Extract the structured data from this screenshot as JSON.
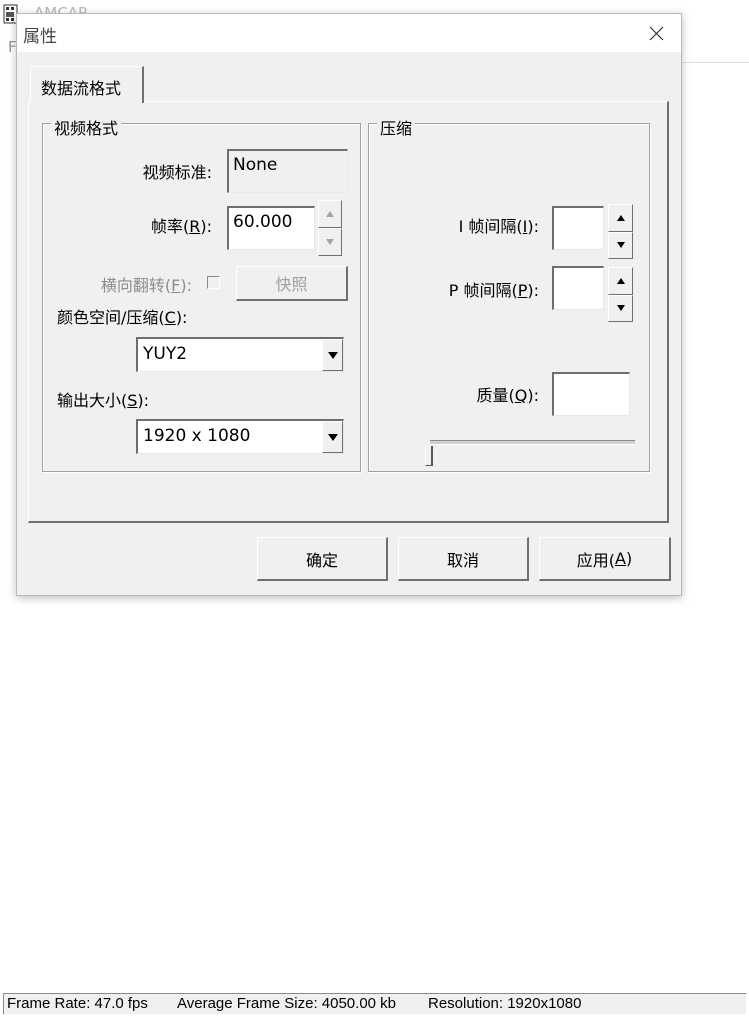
{
  "app": {
    "title": "AMCAP",
    "menu_letter": "F"
  },
  "dialog": {
    "title": "属性",
    "tab_label": "数据流格式",
    "video_format": {
      "group_label": "视频格式",
      "standard_label": "视频标准:",
      "standard_value": "None",
      "frame_rate_label": "帧率(",
      "frame_rate_key": "R",
      "frame_rate_suffix": "):",
      "frame_rate_value": "60.000",
      "flip_label": "横向翻转(",
      "flip_key": "F",
      "flip_suffix": "):",
      "snapshot_label": "快照",
      "color_space_label": "颜色空间/压缩(",
      "color_space_key": "C",
      "color_space_suffix": "):",
      "color_space_value": "YUY2",
      "output_size_label": "输出大小(",
      "output_size_key": "S",
      "output_size_suffix": "):",
      "output_size_value": "1920 x 1080"
    },
    "compression": {
      "group_label": "压缩",
      "i_frame_label": "I 帧间隔(",
      "i_frame_key": "I",
      "i_frame_suffix": "):",
      "i_frame_value": "",
      "p_frame_label": "P 帧间隔(",
      "p_frame_key": "P",
      "p_frame_suffix": "):",
      "p_frame_value": "",
      "quality_label": "质量(",
      "quality_key": "Q",
      "quality_suffix": "):",
      "quality_value": "",
      "quality_slider_level": 0
    },
    "buttons": {
      "ok": "确定",
      "cancel": "取消",
      "apply_label": "应用(",
      "apply_key": "A",
      "apply_suffix": ")"
    }
  },
  "statusbar": {
    "frame_rate": "Frame Rate: 47.0 fps",
    "avg_frame_size": "Average Frame Size: 4050.00 kb",
    "resolution": "Resolution: 1920x1080"
  },
  "icons": {
    "app": "film-reel-icon",
    "close": "close-icon",
    "spin_up": "arrow-up-icon",
    "spin_down": "arrow-down-icon",
    "dropdown": "chevron-down-icon"
  }
}
